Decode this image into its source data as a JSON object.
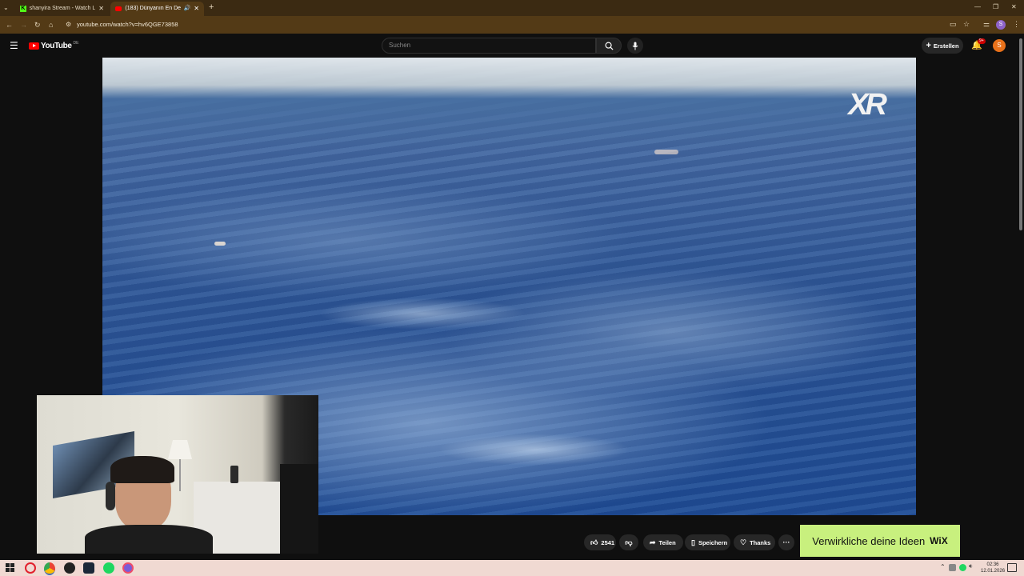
{
  "browser": {
    "tabs": [
      {
        "title": "shanyira Stream - Watch Live o",
        "active": false
      },
      {
        "title": "(183) Dünyanın En Derin N",
        "active": true
      }
    ],
    "url": "youtube.com/watch?v=hv6QGE73858",
    "profile_initial": "S"
  },
  "youtube": {
    "logo": "YouTube",
    "region": "DE",
    "search_placeholder": "Suchen",
    "create_label": "Erstellen",
    "notifications_badge": "9+",
    "avatar_initial": "S"
  },
  "video": {
    "watermark": "XR"
  },
  "actions": {
    "like_count": "2541",
    "share_label": "Teilen",
    "save_label": "Speichern",
    "thanks_label": "Thanks",
    "more_label": "···"
  },
  "ad": {
    "text": "Verwirkliche deine Ideen",
    "brand": "WiX"
  },
  "taskbar": {
    "time": "02:36",
    "date": "12.01.2026"
  },
  "colors": {
    "chrome_bg": "#3b2a12",
    "youtube_red": "#ff0000",
    "ad_bg": "#c8f07e",
    "avatar": "#e8711a"
  }
}
